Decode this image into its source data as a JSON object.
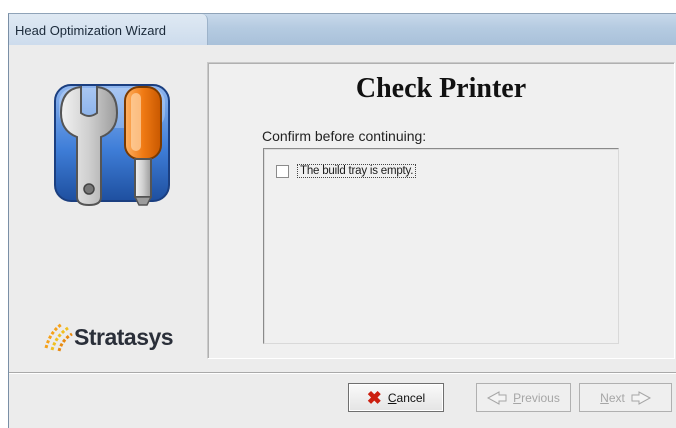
{
  "window": {
    "title": "Head Optimization Wizard"
  },
  "brand": {
    "name": "Stratasys",
    "logo_icon": "wrench-screwdriver-icon",
    "mark_icon": "stratasys-swoosh-icon"
  },
  "page": {
    "heading": "Check Printer",
    "instruction": "Confirm before continuing:",
    "checklist": [
      {
        "label": "The build tray is empty.",
        "checked": false
      }
    ]
  },
  "buttons": {
    "cancel": {
      "label_access": "C",
      "label_rest": "ancel",
      "icon": "x-icon",
      "enabled": true
    },
    "previous": {
      "label_access": "P",
      "label_rest": "revious",
      "icon": "left-arrow-icon",
      "enabled": false
    },
    "next": {
      "label_access": "N",
      "label_rest": "ext",
      "icon": "right-arrow-icon",
      "enabled": false
    }
  },
  "colors": {
    "cancel_x": "#cc1f0f",
    "title_bar": "#b5cbe1",
    "handle_orange": "#f07a14",
    "tile_blue": "#3f7ed8"
  }
}
